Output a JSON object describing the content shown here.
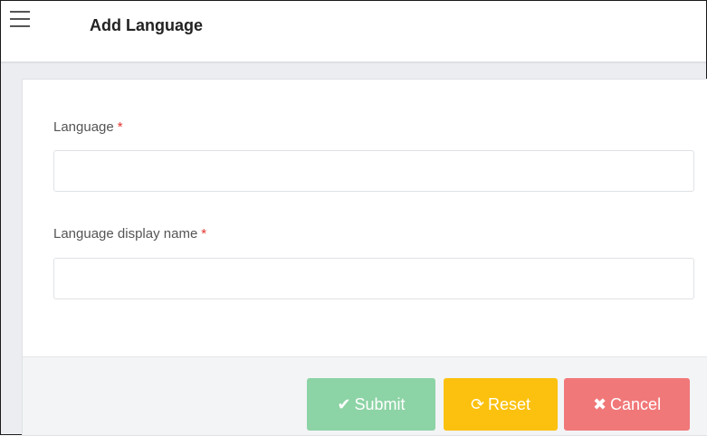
{
  "header": {
    "title": "Add Language"
  },
  "form": {
    "fields": [
      {
        "label": "Language",
        "required_mark": "*",
        "value": "",
        "placeholder": ""
      },
      {
        "label": "Language display name",
        "required_mark": "*",
        "value": "",
        "placeholder": ""
      }
    ]
  },
  "actions": {
    "submit": {
      "icon": "checkmark-icon",
      "glyph": "✔",
      "label": "Submit",
      "color": "#8cd3a5"
    },
    "reset": {
      "icon": "refresh-icon",
      "glyph": "⟳",
      "label": "Reset",
      "color": "#fbc10e"
    },
    "cancel": {
      "icon": "close-icon",
      "glyph": "✖",
      "label": "Cancel",
      "color": "#f17879"
    }
  },
  "colors": {
    "required": "#e3342f"
  }
}
